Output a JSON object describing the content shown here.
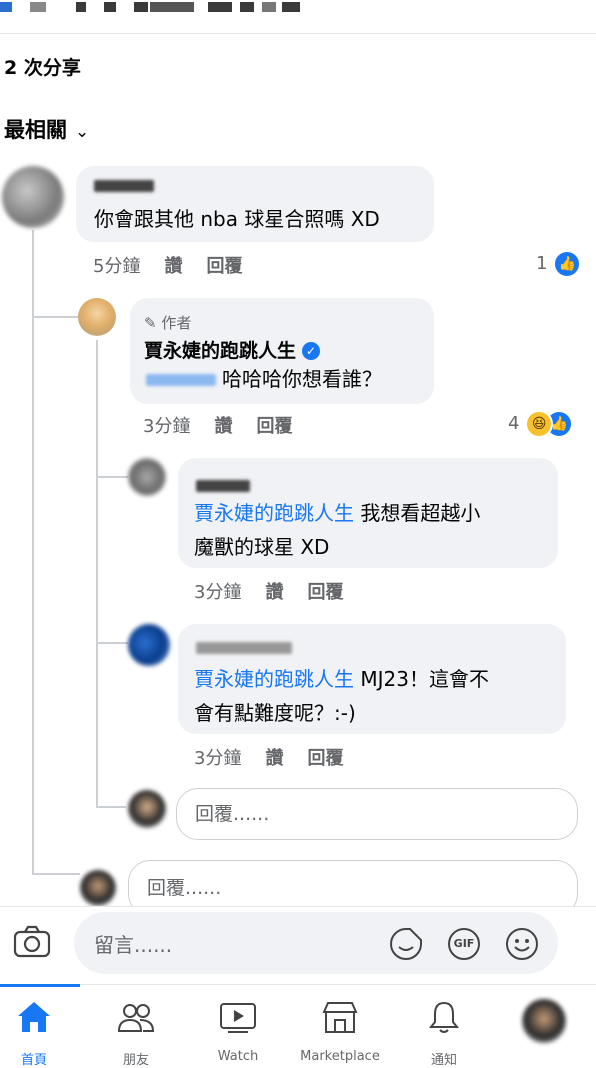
{
  "post": {
    "share_count": "2 次分享",
    "sort_label": "最相關"
  },
  "comments": [
    {
      "text": "你會跟其他 nba 球星合照嗎 XD",
      "time": "5分鐘",
      "like_action": "讚",
      "reply_action": "回覆",
      "reaction_count": "1"
    },
    {
      "author_tag": "作者",
      "author": "賈永婕的跑跳人生",
      "text": "哈哈哈你想看誰？",
      "time": "3分鐘",
      "like_action": "讚",
      "reply_action": "回覆",
      "reaction_count": "4"
    },
    {
      "mention": "賈永婕的跑跳人生",
      "text_part1": "我想看超越小",
      "text_part2": "魔獸的球星 XD",
      "time": "3分鐘",
      "like_action": "讚",
      "reply_action": "回覆"
    },
    {
      "mention": "賈永婕的跑跳人生",
      "text_part1": "MJ23！這會不",
      "text_part2": "會有點難度呢？:-)",
      "time": "3分鐘",
      "like_action": "讚",
      "reply_action": "回覆"
    }
  ],
  "reply_placeholder": "回覆......",
  "reply_placeholder_2": "回覆......",
  "comment_bar": {
    "placeholder": "留言......",
    "gif_label": "GIF"
  },
  "nav": [
    {
      "label": "首頁",
      "icon": "home-icon",
      "active": true
    },
    {
      "label": "朋友",
      "icon": "friends-icon"
    },
    {
      "label": "Watch",
      "icon": "watch-icon"
    },
    {
      "label": "Marketplace",
      "icon": "marketplace-icon"
    },
    {
      "label": "通知",
      "icon": "bell-icon"
    }
  ],
  "colors": {
    "accent": "#1877f2",
    "bubble": "#f0f2f5",
    "secondary_text": "#65676b"
  }
}
